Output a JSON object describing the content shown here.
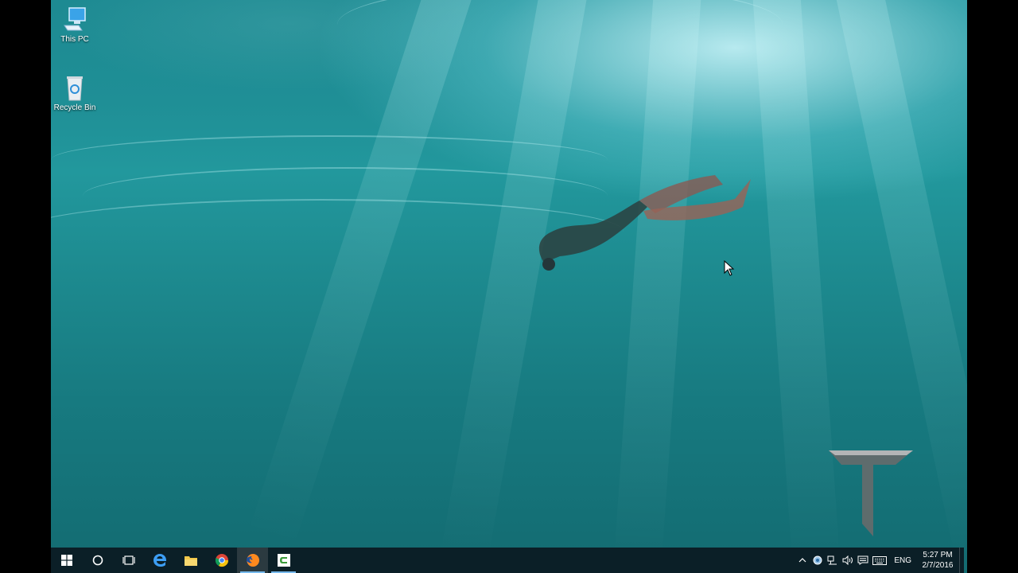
{
  "desktop": {
    "icons": [
      {
        "label": "This PC",
        "icon": "this-pc-icon"
      },
      {
        "label": "Recycle Bin",
        "icon": "recycle-bin-icon"
      }
    ],
    "wallpaper": "underwater-freediver"
  },
  "taskbar": {
    "pinned": [
      {
        "name": "start",
        "icon": "windows-logo-icon"
      },
      {
        "name": "cortana",
        "icon": "search-circle-icon"
      },
      {
        "name": "task-view",
        "icon": "task-view-icon"
      },
      {
        "name": "edge",
        "icon": "edge-icon"
      },
      {
        "name": "file-explorer",
        "icon": "folder-icon"
      },
      {
        "name": "chrome",
        "icon": "chrome-icon"
      },
      {
        "name": "firefox",
        "icon": "firefox-icon"
      },
      {
        "name": "camtasia",
        "icon": "camtasia-icon"
      }
    ],
    "tray": {
      "language": "ENG",
      "time": "5:27 PM",
      "date": "2/7/2016"
    }
  },
  "colors": {
    "taskbar": "#0b1f27",
    "accent": "#76b9ed",
    "water": "#1d8a92"
  }
}
